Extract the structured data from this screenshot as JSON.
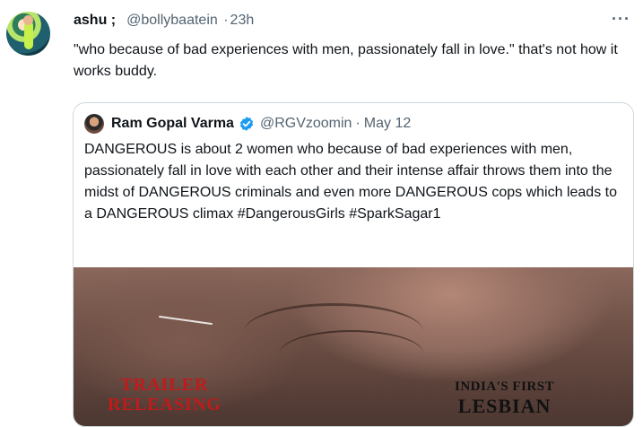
{
  "tweet": {
    "author_name": "ashu ;",
    "handle": "@bollybaatein",
    "time": "23h",
    "text": "\"who because of bad experiences with men, passionately fall in love.\" that's not how it works buddy."
  },
  "more_icon": "more-horizontal-icon",
  "quoted": {
    "author_name": "Ram Gopal Varma",
    "verified": true,
    "handle": "@RGVzoomin",
    "date": "May 12",
    "text": "DANGEROUS is about 2 women who because of bad experiences with men, passionately fall in love with each other and their intense affair throws them into the midst of DANGEROUS criminals and even more DANGEROUS cops which leads to a DANGEROUS climax #DangerousGirls #SparkSagar1",
    "media": {
      "trailer_line1": "TRAILER",
      "trailer_line2": "RELEASING",
      "badge_line1": "INDIA'S FIRST",
      "badge_line2": "LESBIAN"
    }
  },
  "colors": {
    "text": "#0f1419",
    "secondary": "#536471",
    "border": "#cfd9de",
    "verified": "#1d9bf0",
    "trailer_red": "#c21a1a"
  }
}
